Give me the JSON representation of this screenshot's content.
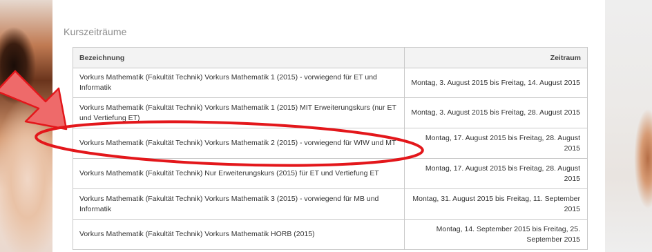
{
  "section": {
    "title": "Kurszeiträume"
  },
  "table": {
    "headers": {
      "name": "Bezeichnung",
      "period": "Zeitraum"
    },
    "rows": [
      {
        "name": "Vorkurs Mathematik (Fakultät Technik) Vorkurs Mathematik 1 (2015) - vorwiegend für ET und Informatik",
        "period": "Montag, 3. August 2015 bis Freitag, 14. August 2015"
      },
      {
        "name": "Vorkurs Mathematik (Fakultät Technik) Vorkurs Mathematik 1 (2015) MIT Erweiterungskurs (nur ET und Vertiefung ET)",
        "period": "Montag, 3. August 2015 bis Freitag, 28. August 2015"
      },
      {
        "name": "Vorkurs Mathematik (Fakultät Technik) Vorkurs Mathematik 2 (2015) - vorwiegend für WIW und MT",
        "period": "Montag, 17. August 2015 bis Freitag, 28. August 2015"
      },
      {
        "name": "Vorkurs Mathematik (Fakultät Technik) Nur Erweiterungskurs (2015) für ET und Vertiefung ET",
        "period": "Montag, 17. August 2015 bis Freitag, 28. August 2015"
      },
      {
        "name": "Vorkurs Mathematik (Fakultät Technik) Vorkurs Mathematik 3 (2015) - vorwiegend für MB und Informatik",
        "period": "Montag, 31. August 2015 bis Freitag, 11. September 2015"
      },
      {
        "name": "Vorkurs Mathematik (Fakultät Technik) Vorkurs Mathematik HORB (2015)",
        "period": "Montag, 14. September 2015 bis Freitag, 25. September 2015"
      }
    ]
  },
  "annotation": {
    "color": "#e3171b",
    "arrow_fill": "#ee6a6a",
    "highlighted_row": 3
  }
}
